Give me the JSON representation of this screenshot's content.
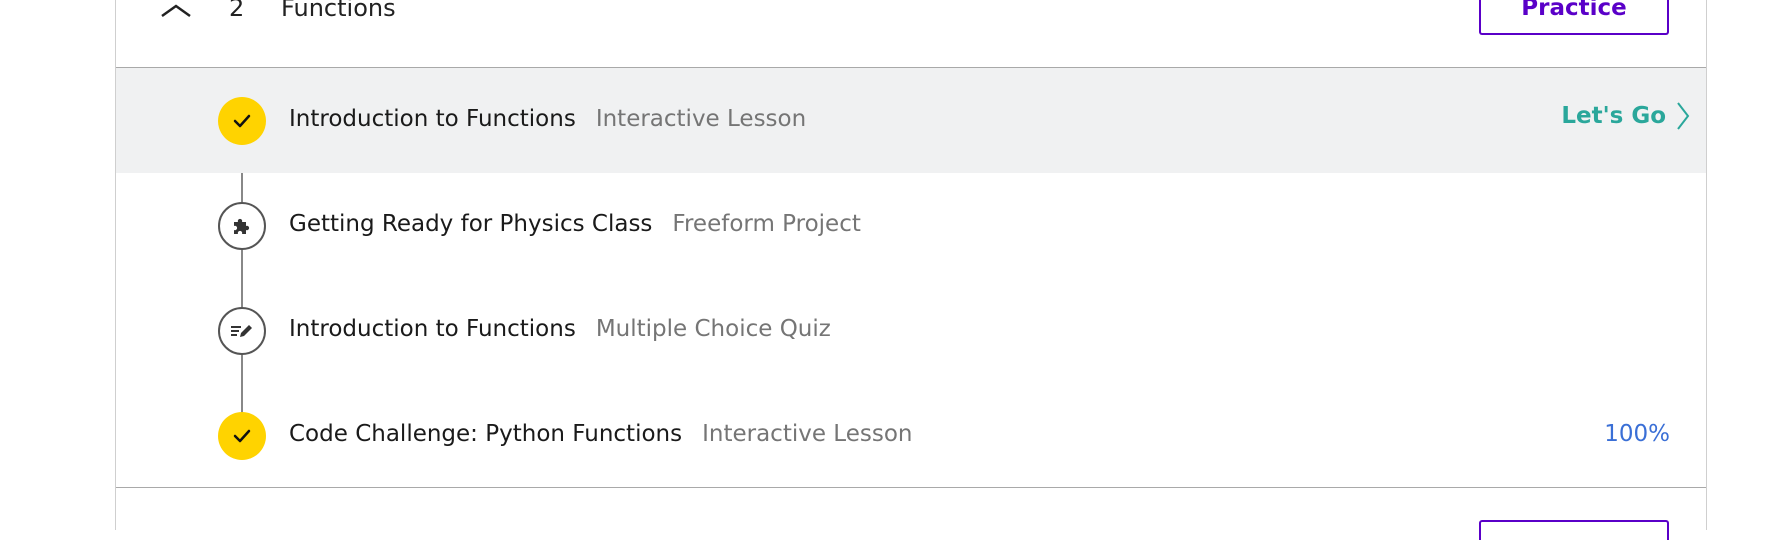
{
  "section": {
    "number": "2",
    "title": "Functions",
    "practice_label": "Practice"
  },
  "lessons": [
    {
      "title": "Introduction to Functions",
      "type": "Interactive Lesson",
      "status": "done",
      "icon": "check-icon",
      "action": "Let's Go"
    },
    {
      "title": "Getting Ready for Physics Class",
      "type": "Freeform Project",
      "status": "todo",
      "icon": "puzzle-icon"
    },
    {
      "title": "Introduction to Functions",
      "type": "Multiple Choice Quiz",
      "status": "todo",
      "icon": "quiz-pencil-icon"
    },
    {
      "title": "Code Challenge: Python Functions",
      "type": "Interactive Lesson",
      "status": "done",
      "icon": "check-icon",
      "progress": "100%"
    }
  ],
  "colors": {
    "accent_purple": "#5a00c8",
    "complete_yellow": "#ffd300",
    "lets_go_teal": "#2aa79b",
    "progress_blue": "#3a6fd6",
    "highlight_bg": "#f0f1f2"
  }
}
